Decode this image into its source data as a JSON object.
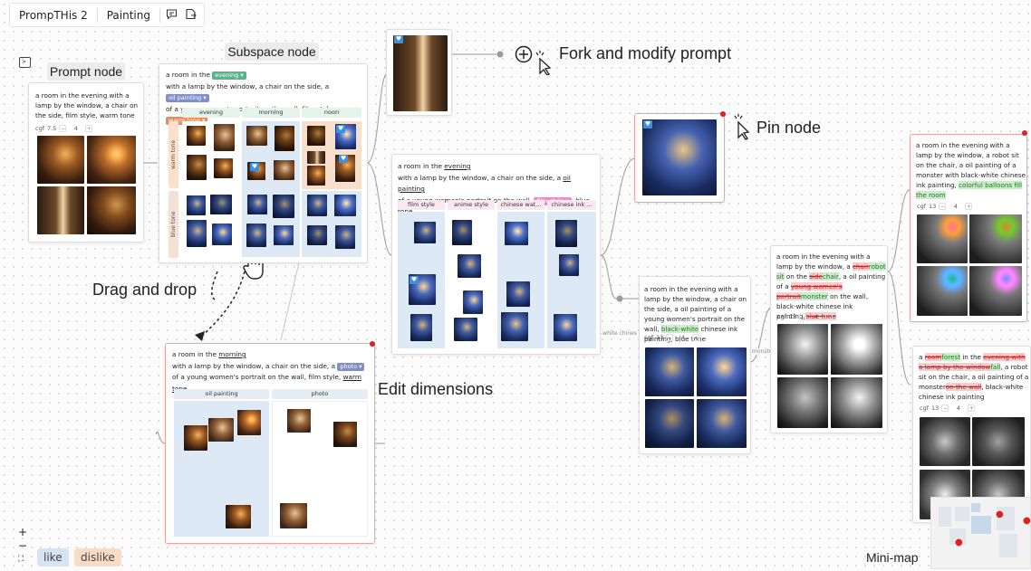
{
  "toolbar": {
    "app_title": "PrompTHis 2",
    "project_name": "Painting",
    "comment_icon": "comment-icon",
    "export_icon": "export-icon"
  },
  "annotations": {
    "prompt_node": "Prompt node",
    "subspace_node": "Subspace node",
    "fork": "Fork and modify prompt",
    "pin": "Pin node",
    "drag": "Drag and drop",
    "edit": "Edit dimensions",
    "minimap": "Mini-map"
  },
  "prompt_node": {
    "text": "a room in the evening with a lamp by the window, a chair on the side, film style, warm tone",
    "cfg_label": "cgf",
    "cfg_value": "7.5",
    "count": "4"
  },
  "subspace_top": {
    "l1_a": "a room in the",
    "chip_evening": "evening ▾",
    "l2_a": "with a lamp by the window, a chair on the side, a",
    "chip_oil": "oil painting ▾",
    "l3_a": "of a young women's portrait on the wall, film style,",
    "chip_warm": "warm tone ▾",
    "cols": [
      "evening",
      "morning",
      "noon"
    ],
    "rows": [
      "warm tone",
      "blue tone"
    ]
  },
  "subspace_mid": {
    "l1_a": "a room in the",
    "l1_u": "evening",
    "l2_a": "with a lamp by the window, a chair on the side, a",
    "l2_u": "oil painting",
    "l3_a": "of a young women's portrait on the wall,",
    "chip_film": "film style ▾",
    "l3_sep": ",",
    "l3_u": "blue tone",
    "cols": [
      "film style",
      "anime style",
      "chinese wat...",
      "chinese ink ..."
    ]
  },
  "subspace_bottom": {
    "l1_a": "a room in the",
    "l1_u": "morning",
    "l2_a": "with a lamp by the window, a chair on the side, a",
    "chip_photo": "photo ▾",
    "l3_a": "of a young women's portrait on the wall, film style,",
    "l3_u": "warm tone",
    "cols": [
      "oil painting",
      "photo"
    ]
  },
  "edge_labels": {
    "white_chinese": "-white chines",
    "monster": "monster"
  },
  "node_bw": {
    "text_a": "a room in the evening with a lamp by the window, a chair on the side, a oil painting of a young women's portrait on the wall,",
    "ins": "black-white",
    "text_b": "chinese ink painting, blue tone",
    "cfg_label": "cgf",
    "cfg_value": "13",
    "count": "4"
  },
  "node_robot": {
    "t1": "a room in the evening with a lamp by the window, a",
    "d1": "chair",
    "i1": "robot sit",
    "t2": "on the",
    "d2": "side",
    "i2": "chair",
    "t3": ", a oil painting of a",
    "d3": "young women's portrait",
    "i3": "monster",
    "t4": "on the wall, black-white chinese ink painting,",
    "d4": "blue tone",
    "cfg_label": "cgf",
    "cfg_value": "13",
    "count": "4"
  },
  "node_balloons": {
    "text_a": "a room in the evening with a lamp by the window, a robot sit on the chair, a oil painting of a monster with black-white chinese ink painting,",
    "ins": "colorful balloons fill the room",
    "cfg_label": "cgf",
    "cfg_value": "13",
    "count": "4"
  },
  "node_forest": {
    "t1": "a",
    "d1": "room",
    "i1": "forest",
    "t2": "in the",
    "d2": "evening with a lamp by the window",
    "i2": "fall",
    "t3": ", a robot sit on the chair, a oil painting of a monster",
    "d3": "on the wall",
    "t4": ", black-white chinese ink painting",
    "cfg_label": "cgf",
    "cfg_value": "13",
    "count": "4"
  },
  "legend": {
    "like": "like",
    "dislike": "dislike"
  },
  "zoom": {
    "plus": "+",
    "minus": "−",
    "fit": "⛶"
  },
  "colors": {
    "like": "#d5e3f3",
    "dislike": "#f8dcc5",
    "pin": "#e0201f",
    "heart": "#3d8fe0"
  }
}
